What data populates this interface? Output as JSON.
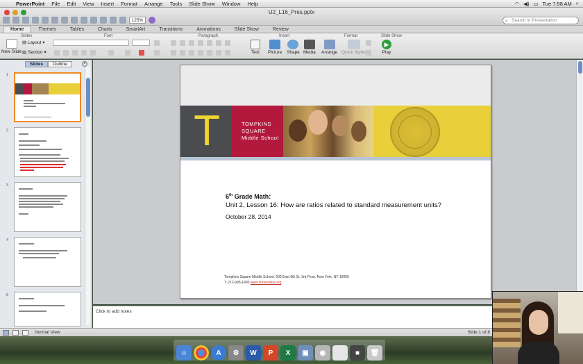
{
  "menubar": {
    "app": "PowerPoint",
    "items": [
      "File",
      "Edit",
      "View",
      "Insert",
      "Format",
      "Arrange",
      "Tools",
      "Slide Show",
      "Window",
      "Help"
    ],
    "clock": "Tue 7:58 AM"
  },
  "window": {
    "title": "U2_L16_Pres.pptx",
    "zoom": "125%",
    "search_placeholder": "Search in Presentation"
  },
  "ribbon": {
    "tabs": [
      "Home",
      "Themes",
      "Tables",
      "Charts",
      "SmartArt",
      "Transitions",
      "Animations",
      "Slide Show",
      "Review"
    ],
    "active_tab": "Home",
    "groups": {
      "slides": "Slides",
      "font": "Font",
      "paragraph": "Paragraph",
      "insert": "Insert",
      "format": "Format",
      "slide_show": "Slide Show"
    },
    "buttons": {
      "new_slide": "New Slide",
      "layout": "Layout",
      "section": "Section",
      "text": "Text",
      "picture": "Picture",
      "shape": "Shape",
      "media": "Media",
      "arrange": "Arrange",
      "quick_styles": "Quick Styles",
      "play": "Play"
    }
  },
  "left_panel": {
    "tab_slides": "Slides",
    "tab_outline": "Outline",
    "slide_numbers": [
      "1",
      "2",
      "3",
      "4",
      "5"
    ]
  },
  "slide": {
    "logo_letter": "T",
    "school_line1": "TOMPKINS",
    "school_line2": "SQUARE",
    "school_line3": "Middle School",
    "title_pre": "6",
    "title_sup": "th",
    "title_post": " Grade Math:",
    "subtitle": "Unit 2, Lesson 16: How are ratios related to standard measurement units?",
    "date": "October 28, 2014",
    "footer_address": "Tompkins Square Middle School, 600 East 6th St, 3rd Floor, New York, NY 10009",
    "footer_phone": "T: 212-995-1430",
    "footer_link": "www.tsmsonline.org"
  },
  "notes": {
    "placeholder": "Click to add notes"
  },
  "status": {
    "view_mode": "Normal View",
    "slide_count": "Slide 1 of 8"
  }
}
